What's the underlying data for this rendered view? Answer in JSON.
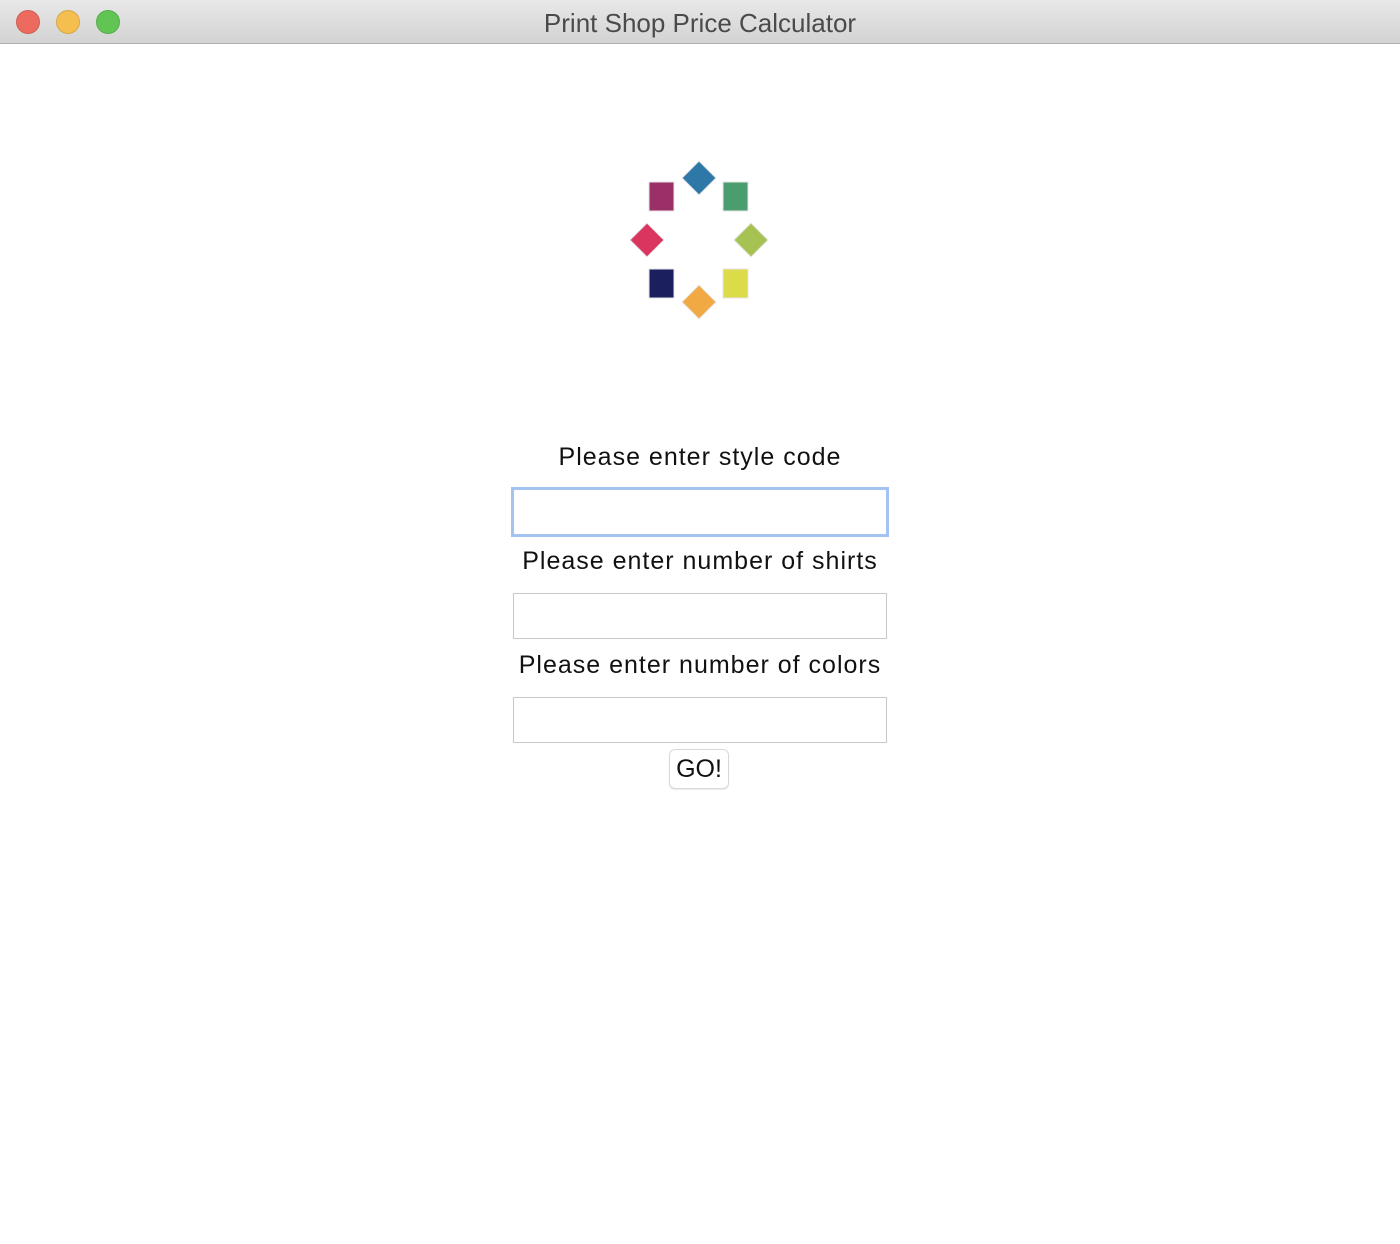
{
  "window": {
    "title": "Print Shop Price Calculator",
    "controls": {
      "close_color": "#ed6a5e",
      "minimize_color": "#f5bf4f",
      "zoom_color": "#61c554"
    }
  },
  "logo": {
    "icon": "color-diamond-ring-logo",
    "colors": [
      "#2e78a8",
      "#4a9d6e",
      "#a6c252",
      "#dcdb4a",
      "#f0a943",
      "#1b1f5e",
      "#d9355f",
      "#9b2f68"
    ]
  },
  "form": {
    "style_code": {
      "label": "Please enter style code",
      "value": "",
      "placeholder": ""
    },
    "num_shirts": {
      "label": "Please enter number of shirts",
      "value": "",
      "placeholder": ""
    },
    "num_colors": {
      "label": "Please enter number of colors",
      "value": "",
      "placeholder": ""
    },
    "submit_label": "GO!"
  },
  "colors": {
    "focus_ring": "#a3c3f3",
    "input_border": "#c8c8c8"
  }
}
